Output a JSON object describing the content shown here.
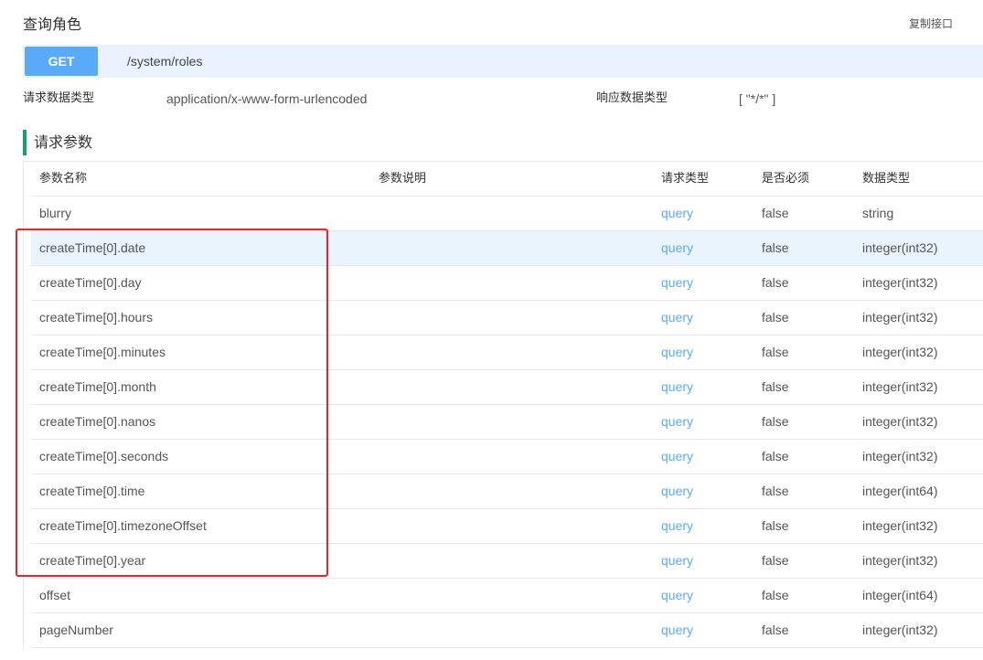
{
  "page": {
    "title": "查询角色",
    "copy_label": "复制接口"
  },
  "endpoint": {
    "method": "GET",
    "path": "/system/roles"
  },
  "meta": {
    "request_type_label": "请求数据类型",
    "request_type_value": "application/x-www-form-urlencoded",
    "response_type_label": "响应数据类型",
    "response_type_value": "[ \"*/*\" ]"
  },
  "params": {
    "section_title": "请求参数",
    "columns": [
      "参数名称",
      "参数说明",
      "请求类型",
      "是否必须",
      "数据类型"
    ],
    "rows": [
      {
        "name": "blurry",
        "desc": "",
        "in": "query",
        "required": "false",
        "type": "string"
      },
      {
        "name": "createTime[0].date",
        "desc": "",
        "in": "query",
        "required": "false",
        "type": "integer(int32)"
      },
      {
        "name": "createTime[0].day",
        "desc": "",
        "in": "query",
        "required": "false",
        "type": "integer(int32)"
      },
      {
        "name": "createTime[0].hours",
        "desc": "",
        "in": "query",
        "required": "false",
        "type": "integer(int32)"
      },
      {
        "name": "createTime[0].minutes",
        "desc": "",
        "in": "query",
        "required": "false",
        "type": "integer(int32)"
      },
      {
        "name": "createTime[0].month",
        "desc": "",
        "in": "query",
        "required": "false",
        "type": "integer(int32)"
      },
      {
        "name": "createTime[0].nanos",
        "desc": "",
        "in": "query",
        "required": "false",
        "type": "integer(int32)"
      },
      {
        "name": "createTime[0].seconds",
        "desc": "",
        "in": "query",
        "required": "false",
        "type": "integer(int32)"
      },
      {
        "name": "createTime[0].time",
        "desc": "",
        "in": "query",
        "required": "false",
        "type": "integer(int64)"
      },
      {
        "name": "createTime[0].timezoneOffset",
        "desc": "",
        "in": "query",
        "required": "false",
        "type": "integer(int32)"
      },
      {
        "name": "createTime[0].year",
        "desc": "",
        "in": "query",
        "required": "false",
        "type": "integer(int32)"
      },
      {
        "name": "offset",
        "desc": "",
        "in": "query",
        "required": "false",
        "type": "integer(int64)"
      },
      {
        "name": "pageNumber",
        "desc": "",
        "in": "query",
        "required": "false",
        "type": "integer(int32)"
      }
    ]
  },
  "colors": {
    "accent": "#5aaafa",
    "section_bar": "#15a26b",
    "highlight_row": "#eaf4fd",
    "annotation_box": "#e8262a"
  }
}
